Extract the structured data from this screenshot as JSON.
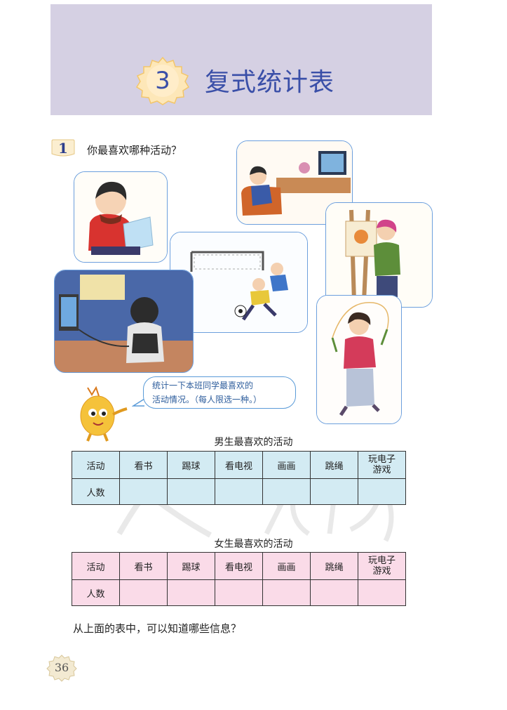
{
  "header": {
    "chapter_number": "3",
    "chapter_title": "复式统计表"
  },
  "question": {
    "number": "1",
    "text": "你最喜欢哪种活动？"
  },
  "speech_bubble": {
    "line1": "统计一下本班同学最喜欢的",
    "line2": "活动情况。（每人限选一种。）"
  },
  "boys_table": {
    "title": "男生最喜欢的活动",
    "header_label": "活动",
    "columns": [
      "看书",
      "踢球",
      "看电视",
      "画画",
      "跳绳",
      "玩电子游戏"
    ],
    "row_label": "人数",
    "values": [
      "",
      "",
      "",
      "",
      "",
      ""
    ],
    "color": "#d3ebf3"
  },
  "girls_table": {
    "title": "女生最喜欢的活动",
    "header_label": "活动",
    "columns": [
      "看书",
      "踢球",
      "看电视",
      "画画",
      "跳绳",
      "玩电子游戏"
    ],
    "row_label": "人数",
    "values": [
      "",
      "",
      "",
      "",
      "",
      ""
    ],
    "color": "#fadbe8"
  },
  "footer_question": "从上面的表中，可以知道哪些信息？",
  "page_number": "36",
  "colors": {
    "banner": "#d5d0e3",
    "title": "#3a4fa8",
    "picture_border": "#6c9fdd"
  }
}
